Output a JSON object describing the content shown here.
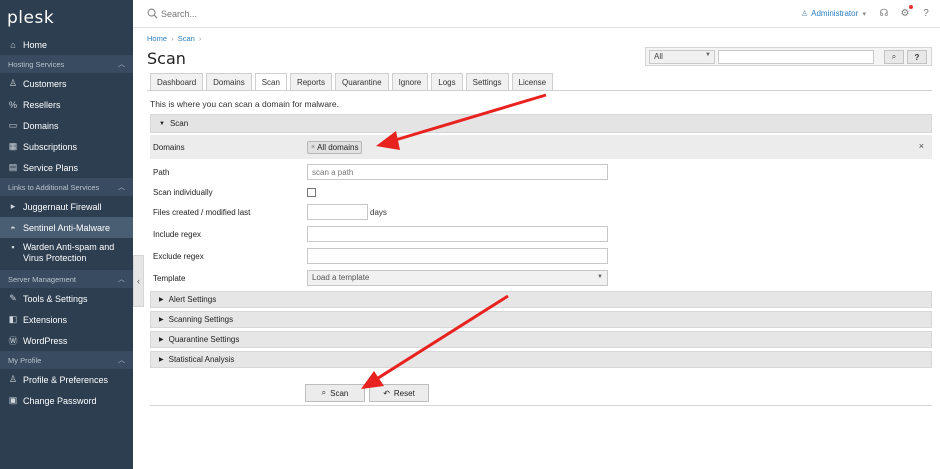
{
  "app": {
    "logo": "plesk"
  },
  "sidebar": {
    "items": [
      {
        "icon": "home-icon",
        "glyph": "⌂",
        "label": "Home"
      },
      {
        "section": "Hosting Services"
      },
      {
        "icon": "user-icon",
        "glyph": "♙",
        "label": "Customers"
      },
      {
        "icon": "percent-icon",
        "glyph": "%",
        "label": "Resellers"
      },
      {
        "icon": "monitor-icon",
        "glyph": "▭",
        "label": "Domains"
      },
      {
        "icon": "grid-icon",
        "glyph": "▦",
        "label": "Subscriptions"
      },
      {
        "icon": "document-icon",
        "glyph": "▤",
        "label": "Service Plans"
      },
      {
        "section": "Links to Additional Services"
      },
      {
        "icon": "arrow-icon",
        "glyph": "▸",
        "label": "Juggernaut Firewall"
      },
      {
        "icon": "eye-icon",
        "glyph": "◓",
        "label": "Sentinel Anti-Malware",
        "active": true
      },
      {
        "icon": "shield-icon",
        "glyph": "▪",
        "label": "Warden Anti-spam and",
        "label2": "Virus Protection"
      },
      {
        "section": "Server Management"
      },
      {
        "icon": "tools-icon",
        "glyph": "✎",
        "label": "Tools & Settings"
      },
      {
        "icon": "puzzle-icon",
        "glyph": "◧",
        "label": "Extensions"
      },
      {
        "icon": "wordpress-icon",
        "glyph": "Ⓦ",
        "label": "WordPress"
      },
      {
        "section": "My Profile"
      },
      {
        "icon": "profile-icon",
        "glyph": "♙",
        "label": "Profile & Preferences"
      },
      {
        "icon": "lock-icon",
        "glyph": "▣",
        "label": "Change Password"
      }
    ]
  },
  "topbar": {
    "search_placeholder": "Search...",
    "user": "Administrator",
    "user_caret": "▾"
  },
  "breadcrumb": [
    "Home",
    "Scan"
  ],
  "page": {
    "title": "Scan",
    "intro": "This is where you can scan a domain for malware."
  },
  "filter": {
    "selected": "All",
    "search_button": "⌕",
    "help_button": "?"
  },
  "tabs": [
    "Dashboard",
    "Domains",
    "Scan",
    "Reports",
    "Quarantine",
    "Ignore",
    "Logs",
    "Settings",
    "License"
  ],
  "active_tab": "Scan",
  "form": {
    "section_title": "Scan",
    "domains_label": "Domains",
    "domains_tag": "All domains",
    "domains_tag_remove": "×",
    "domains_clear": "×",
    "path_label": "Path",
    "path_placeholder": "scan a path",
    "scan_individually_label": "Scan individually",
    "files_label": "Files created / modified last",
    "days_label": "days",
    "include_label": "Include regex",
    "exclude_label": "Exclude regex",
    "template_label": "Template",
    "template_value": "Load a template"
  },
  "collapsed_sections": [
    "Alert Settings",
    "Scanning Settings",
    "Quarantine Settings",
    "Statistical Analysis"
  ],
  "buttons": {
    "scan": "Scan",
    "reset": "Reset"
  },
  "colors": {
    "sidebar": "#2d3e50",
    "link": "#2a7fc4",
    "arrow": "#e8231f"
  }
}
